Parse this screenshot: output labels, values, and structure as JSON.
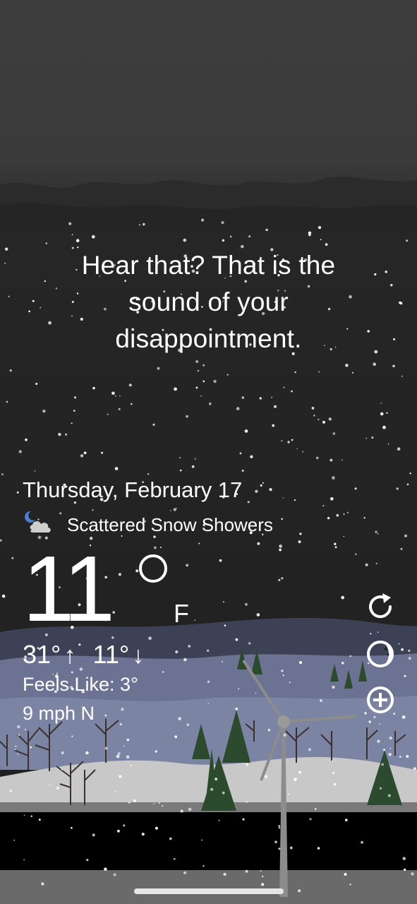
{
  "quote": {
    "lines": [
      "Hear that? That is the",
      "sound of your",
      "disappointment."
    ]
  },
  "weather": {
    "date": "Thursday, February 17",
    "condition": "Scattered Snow Showers",
    "condition_icon": "partly-cloudy-night-snow-icon",
    "temperature": "11",
    "unit": "F",
    "high": "31°",
    "low": "11°",
    "feels_like": "Feels Like: 3°",
    "wind": "9 mph N"
  },
  "actions": [
    {
      "name": "refresh-icon"
    },
    {
      "name": "moon-phase-icon"
    },
    {
      "name": "add-location-icon"
    }
  ],
  "colors": {
    "sky_top": "#3d3d3d",
    "sky_night": "#212121",
    "hills_far": "#3f4358",
    "hills_mid": "#6f7694",
    "snow_ground": "#c9c9c9",
    "bottom_bar": "#000000",
    "tree": "#2d4b2f",
    "text": "#ffffff"
  }
}
